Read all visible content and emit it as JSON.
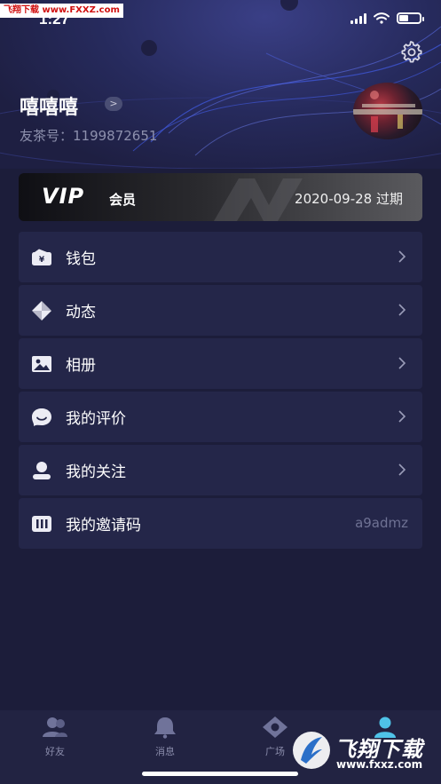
{
  "watermark": "飞翔下载 www.FXXZ.com",
  "status_bar": {
    "time": "1:27",
    "battery_level": 0.45
  },
  "profile": {
    "username": "嘻嘻嘻",
    "name_chevron": ">",
    "uid_text": "友茶号：1199872651"
  },
  "vip": {
    "title": "VIP",
    "subtitle": "会员",
    "expire_text": "2020-09-28 过期"
  },
  "menu": [
    {
      "label": "钱包",
      "icon": "wallet-icon",
      "chevron": true
    },
    {
      "label": "动态",
      "icon": "moments-icon",
      "chevron": true
    },
    {
      "label": "相册",
      "icon": "album-icon",
      "chevron": true
    },
    {
      "label": "我的评价",
      "icon": "comment-icon",
      "chevron": true
    },
    {
      "label": "我的关注",
      "icon": "follow-icon",
      "chevron": true
    },
    {
      "label": "我的邀请码",
      "icon": "invite-code-icon",
      "value": "a9admz"
    }
  ],
  "tabbar": {
    "tabs": [
      {
        "label": "好友",
        "icon": "friends-icon"
      },
      {
        "label": "消息",
        "icon": "message-icon"
      },
      {
        "label": "广场",
        "icon": "square-icon"
      },
      {
        "label": "",
        "icon": "profile-icon"
      }
    ]
  },
  "brand": {
    "text": "飞翔下载",
    "url": "www.fxxz.com"
  },
  "colors": {
    "background": "#1c1d3a",
    "menu_bg": "#242649",
    "accent": "#4fc3e8"
  }
}
